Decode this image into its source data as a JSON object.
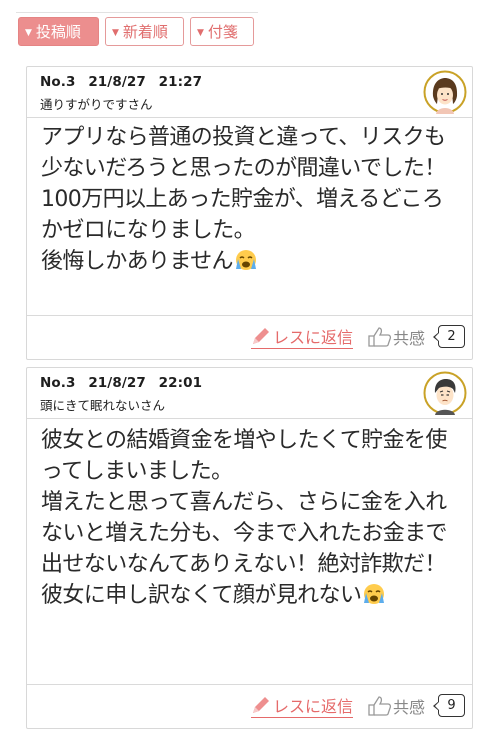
{
  "sort_tabs": [
    {
      "label": "投稿順",
      "active": true
    },
    {
      "label": "新着順",
      "active": false
    },
    {
      "label": "付箋",
      "active": false
    }
  ],
  "posts": [
    {
      "number": "No.3",
      "date": "21/8/27",
      "time": "21:27",
      "author": "通りすがりですさん",
      "avatar": "woman-avatar-icon",
      "body": "アプリなら普通の投資と違って、リスクも少ないだろうと思ったのが間違いでした！100万円以上あった貯金が、増えるどころかゼロになりました。\n後悔しかありません",
      "emoji": "crying-face-emoji",
      "reply_label": "レスに返信",
      "like_label": "共感",
      "like_count": "2"
    },
    {
      "number": "No.3",
      "date": "21/8/27",
      "time": "22:01",
      "author": "頭にきて眠れないさん",
      "avatar": "man-avatar-icon",
      "body": "彼女との結婚資金を増やしたくて貯金を使ってしまいました。\n増えたと思って喜んだら、さらに金を入れないと増えた分も、今まで入れたお金まで出せないなんてありえない！絶対詐欺だ！彼女に申し訳なくて顔が見れない",
      "emoji": "crying-face-emoji",
      "reply_label": "レスに返信",
      "like_label": "共感",
      "like_count": "9"
    }
  ],
  "colors": {
    "accent": "#e56a6a",
    "tab_active_bg": "#ec8e8e",
    "border": "#d8d8d8"
  }
}
